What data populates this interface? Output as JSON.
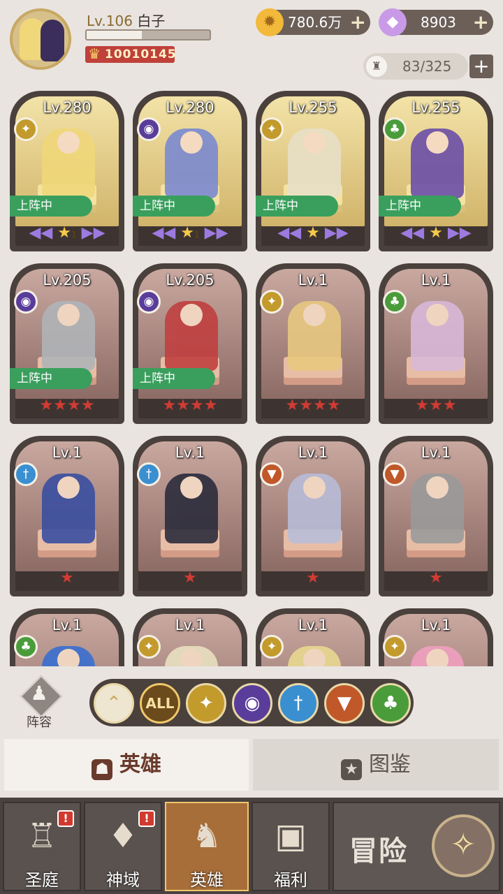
{
  "player": {
    "level": "Lv.106",
    "name": "白子",
    "power": "10010145",
    "exp_fraction": 0.45
  },
  "currency": {
    "gold": "780.6万",
    "diamonds": "8903",
    "hero_slots": "83/325"
  },
  "heroes": [
    {
      "level": "Lv.280",
      "faction": "light",
      "deployed": true,
      "stars": "purple",
      "star_count": "1",
      "bg": "gold"
    },
    {
      "level": "Lv.280",
      "faction": "dark",
      "deployed": true,
      "stars": "purple",
      "star_count": "1",
      "bg": "gold"
    },
    {
      "level": "Lv.255",
      "faction": "light",
      "deployed": true,
      "stars": "purple",
      "star_count": "",
      "bg": "gold"
    },
    {
      "level": "Lv.255",
      "faction": "nature",
      "deployed": true,
      "stars": "purple",
      "star_count": "",
      "bg": "gold"
    },
    {
      "level": "Lv.205",
      "faction": "dark",
      "deployed": true,
      "stars": "red",
      "star_count": "4",
      "bg": "brown"
    },
    {
      "level": "Lv.205",
      "faction": "dark",
      "deployed": true,
      "stars": "red",
      "star_count": "4",
      "bg": "brown"
    },
    {
      "level": "Lv.1",
      "faction": "light",
      "deployed": false,
      "stars": "red",
      "star_count": "4",
      "bg": "brown"
    },
    {
      "level": "Lv.1",
      "faction": "nature",
      "deployed": false,
      "stars": "red",
      "star_count": "3",
      "bg": "brown"
    },
    {
      "level": "Lv.1",
      "faction": "water",
      "deployed": false,
      "stars": "red",
      "star_count": "1",
      "bg": "brown"
    },
    {
      "level": "Lv.1",
      "faction": "water",
      "deployed": false,
      "stars": "red",
      "star_count": "1",
      "bg": "brown"
    },
    {
      "level": "Lv.1",
      "faction": "fire",
      "deployed": false,
      "stars": "red",
      "star_count": "1",
      "bg": "brown"
    },
    {
      "level": "Lv.1",
      "faction": "fire",
      "deployed": false,
      "stars": "red",
      "star_count": "1",
      "bg": "brown"
    },
    {
      "level": "Lv.1",
      "faction": "nature",
      "deployed": false,
      "stars": "red",
      "star_count": "",
      "bg": "brown"
    },
    {
      "level": "Lv.1",
      "faction": "light",
      "deployed": false,
      "stars": "red",
      "star_count": "",
      "bg": "brown"
    },
    {
      "level": "Lv.1",
      "faction": "light",
      "deployed": false,
      "stars": "red",
      "star_count": "",
      "bg": "brown"
    },
    {
      "level": "Lv.1",
      "faction": "light",
      "deployed": false,
      "stars": "red",
      "star_count": "",
      "bg": "brown"
    }
  ],
  "labels": {
    "deployed": "上阵中",
    "lineup": "阵容",
    "filter_all": "ALL"
  },
  "tabs": {
    "heroes": "英雄",
    "codex": "图鉴"
  },
  "nav": {
    "courtyard": "圣庭",
    "divine": "神域",
    "heroes": "英雄",
    "welfare": "福利",
    "adventure": "冒险",
    "badge": "!"
  },
  "colors": {
    "light": "#c39a2c",
    "dark": "#5a3d9a",
    "water": "#3a8fd0",
    "fire": "#c0582a",
    "nature": "#4a9c3a"
  }
}
